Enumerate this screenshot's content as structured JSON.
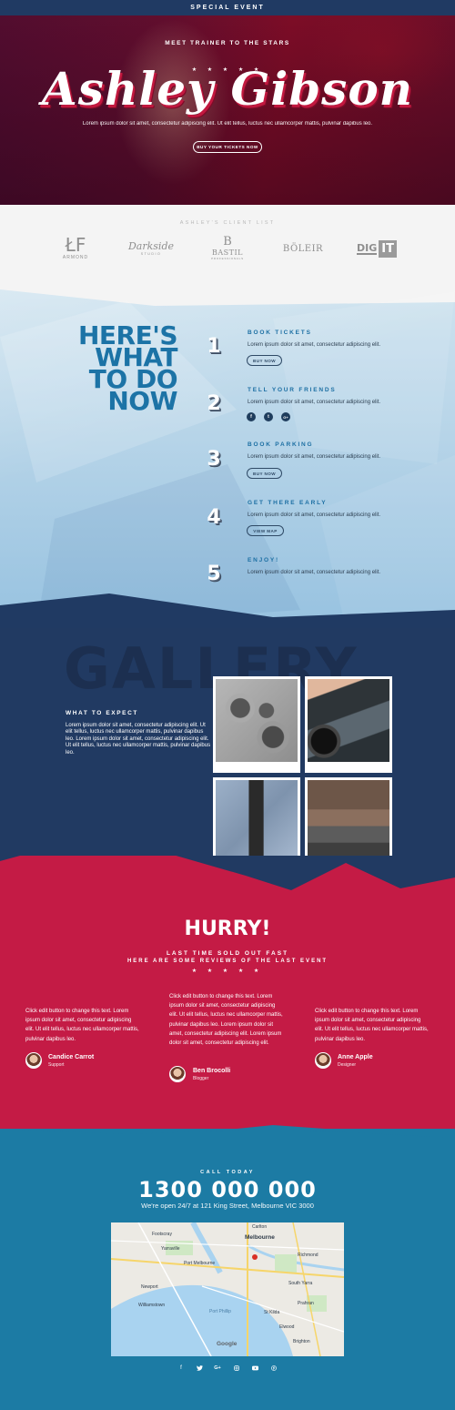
{
  "topbar": {
    "label": "SPECIAL EVENT"
  },
  "hero": {
    "kicker": "MEET TRAINER TO THE STARS",
    "stars": "★ ★ ★ ★ ★",
    "name": "Ashley Gibson",
    "text": "Lorem ipsum dolor sit amet, consectetur adipiscing elit. Ut elit tellus, luctus nec ullamcorper mattis, pulvinar dapibus leo.",
    "button": "BUY YOUR TICKETS NOW"
  },
  "clients": {
    "title": "ASHLEY'S CLIENT LIST",
    "logos": [
      {
        "name": "ARMOND",
        "mark": "ŁF"
      },
      {
        "name": "Darkside",
        "sub": "STUDIO"
      },
      {
        "name": "BASTIL",
        "mark": "B",
        "sub": "PROFESSIONALS"
      },
      {
        "name": "BÖLEIR"
      },
      {
        "name": "DIG",
        "mark": "IT"
      }
    ]
  },
  "steps": {
    "headline": [
      "HERE'S",
      "WHAT",
      "TO DO",
      "NOW"
    ],
    "items": [
      {
        "num": "1",
        "title": "BOOK TICKETS",
        "desc": "Lorem ipsum dolor sit amet, consectetur adipiscing elit.",
        "button": "BUY NOW"
      },
      {
        "num": "2",
        "title": "TELL YOUR FRIENDS",
        "desc": "Lorem ipsum dolor sit amet, consectetur adipiscing elit.",
        "social": [
          "f",
          "t",
          "G+"
        ]
      },
      {
        "num": "3",
        "title": "BOOK PARKING",
        "desc": "Lorem ipsum dolor sit amet, consectetur adipiscing elit.",
        "button": "BUY NOW"
      },
      {
        "num": "4",
        "title": "GET THERE EARLY",
        "desc": "Lorem ipsum dolor sit amet, consectetur adipiscing elit.",
        "button": "VIEW MAP"
      },
      {
        "num": "5",
        "title": "ENJOY!",
        "desc": "Lorem ipsum dolor sit amet, consectetur adipiscing elit."
      }
    ]
  },
  "gallery": {
    "big": "GALLERY",
    "kicker": "WHAT TO EXPECT",
    "text": "Lorem ipsum dolor sit amet, consectetur adipiscing elit. Ut elit tellus, luctus nec ullamcorper mattis, pulvinar dapibus leo. Lorem ipsum dolor sit amet, consectetur adipiscing elit. Ut elit tellus, luctus nec ullamcorper mattis, pulvinar dapibus leo."
  },
  "hurry": {
    "title": "HURRY!",
    "sub1": "LAST TIME SOLD OUT FAST",
    "sub2": "HERE ARE SOME REVIEWS OF THE LAST EVENT",
    "stars": "★ ★ ★ ★ ★",
    "reviews": [
      {
        "text": "Click edit button to change this text. Lorem ipsum dolor sit amet, consectetur adipiscing elit. Ut elit tellus, luctus nec ullamcorper mattis, pulvinar dapibus leo.",
        "name": "Candice Carrot",
        "role": "Support"
      },
      {
        "text": "Click edit button to change this text. Lorem ipsum dolor sit amet, consectetur adipiscing elit. Ut elit tellus, luctus nec ullamcorper mattis, pulvinar dapibus leo. Lorem ipsum dolor sit amet, consectetur adipiscing elit. Lorem ipsum dolor sit amet, consectetur adipiscing elit.",
        "name": "Ben Brocolli",
        "role": "Blogger"
      },
      {
        "text": "Click edit button to change this text. Lorem ipsum dolor sit amet, consectetur adipiscing elit. Ut elit tellus, luctus nec ullamcorper mattis, pulvinar dapibus leo.",
        "name": "Anne Apple",
        "role": "Designer"
      }
    ]
  },
  "contact": {
    "kicker": "CALL TODAY",
    "phone": "1300 000 000",
    "open": "We're open 24/7 at 121 King Street, Melbourne VIC 3000",
    "map_labels": [
      "Melbourne",
      "Port Melbourne",
      "St Kilda",
      "Richmond",
      "Williamstown",
      "Newport",
      "Footscray",
      "Brighton",
      "Google",
      "Yarraville",
      "Carlton",
      "Prahran",
      "South Yarra",
      "Elwood",
      "Port Phillip"
    ]
  },
  "footer_icons": [
    "facebook-icon",
    "twitter-icon",
    "google-plus-icon",
    "instagram-icon",
    "youtube-icon",
    "pinterest-icon"
  ],
  "colors": {
    "navy": "#203a63",
    "crimson": "#c41b45",
    "teal": "#1c7ba4",
    "step_blue": "#1c73a6"
  }
}
